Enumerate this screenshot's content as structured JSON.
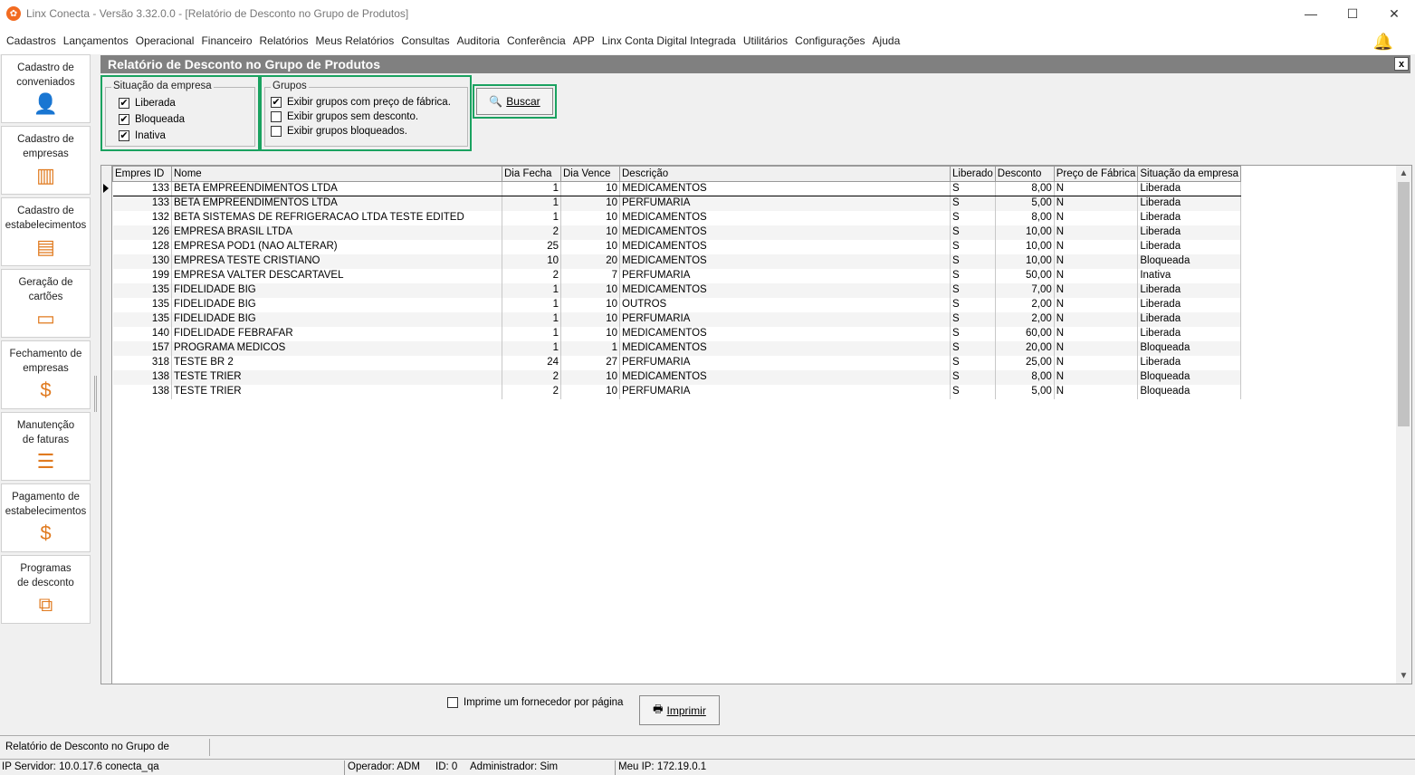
{
  "window": {
    "title": "Linx Conecta - Versão 3.32.0.0 - [Relatório de Desconto no Grupo de Produtos]",
    "minimize": "—",
    "maximize": "☐",
    "close": "✕"
  },
  "menu": [
    "Cadastros",
    "Lançamentos",
    "Operacional",
    "Financeiro",
    "Relatórios",
    "Meus Relatórios",
    "Consultas",
    "Auditoria",
    "Conferência",
    "APP",
    "Linx Conta Digital Integrada",
    "Utilitários",
    "Configurações",
    "Ajuda"
  ],
  "sidebar": [
    {
      "label1": "Cadastro de",
      "label2": "conveniados",
      "icon": "person-icon",
      "glyph": "👤"
    },
    {
      "label1": "Cadastro de",
      "label2": "empresas",
      "icon": "building-icon",
      "glyph": "▥"
    },
    {
      "label1": "Cadastro de",
      "label2": "estabelecimentos",
      "icon": "store-icon",
      "glyph": "▤"
    },
    {
      "label1": "Geração de",
      "label2": "cartões",
      "icon": "card-icon",
      "glyph": "▭"
    },
    {
      "label1": "Fechamento de",
      "label2": "empresas",
      "icon": "invoice-icon",
      "glyph": "$"
    },
    {
      "label1": "Manutenção",
      "label2": "de faturas",
      "icon": "tray-icon",
      "glyph": "☰"
    },
    {
      "label1": "Pagamento de",
      "label2": "estabelecimentos",
      "icon": "payment-icon",
      "glyph": "$"
    },
    {
      "label1": "Programas",
      "label2": "de desconto",
      "icon": "discount-icon",
      "glyph": "⧉"
    }
  ],
  "panel": {
    "title": "Relatório de Desconto no Grupo de Produtos",
    "close": "x"
  },
  "situacao": {
    "legend": "Situação da empresa",
    "options": [
      {
        "label": "Liberada",
        "checked": "✔"
      },
      {
        "label": "Bloqueada",
        "checked": "✔"
      },
      {
        "label": "Inativa",
        "checked": "✔"
      }
    ]
  },
  "grupos": {
    "legend": "Grupos",
    "options": [
      {
        "label": "Exibir grupos com preço de fábrica.",
        "checked": "✔"
      },
      {
        "label": "Exibir grupos sem desconto.",
        "checked": ""
      },
      {
        "label": "Exibir grupos bloqueados.",
        "checked": ""
      }
    ]
  },
  "buscar_label": "Buscar",
  "grid": {
    "columns": [
      "Empres ID",
      "Nome",
      "Dia Fecha",
      "Dia Vence",
      "Descrição",
      "Liberado",
      "Desconto",
      "Preço de Fábrica",
      "Situação da empresa"
    ],
    "rows": [
      [
        "133",
        "BETA EMPREENDIMENTOS LTDA",
        "1",
        "10",
        "MEDICAMENTOS",
        "S",
        "8,00",
        "N",
        "Liberada"
      ],
      [
        "133",
        "BETA EMPREENDIMENTOS LTDA",
        "1",
        "10",
        "PERFUMARIA",
        "S",
        "5,00",
        "N",
        "Liberada"
      ],
      [
        "132",
        "BETA SISTEMAS DE REFRIGERACAO LTDA TESTE EDITED",
        "1",
        "10",
        "MEDICAMENTOS",
        "S",
        "8,00",
        "N",
        "Liberada"
      ],
      [
        "126",
        "EMPRESA BRASIL LTDA",
        "2",
        "10",
        "MEDICAMENTOS",
        "S",
        "10,00",
        "N",
        "Liberada"
      ],
      [
        "128",
        "EMPRESA POD1 (NAO ALTERAR)",
        "25",
        "10",
        "MEDICAMENTOS",
        "S",
        "10,00",
        "N",
        "Liberada"
      ],
      [
        "130",
        "EMPRESA TESTE CRISTIANO",
        "10",
        "20",
        "MEDICAMENTOS",
        "S",
        "10,00",
        "N",
        "Bloqueada"
      ],
      [
        "199",
        "EMPRESA VALTER DESCARTAVEL",
        "2",
        "7",
        "PERFUMARIA",
        "S",
        "50,00",
        "N",
        "Inativa"
      ],
      [
        "135",
        "FIDELIDADE BIG",
        "1",
        "10",
        "MEDICAMENTOS",
        "S",
        "7,00",
        "N",
        "Liberada"
      ],
      [
        "135",
        "FIDELIDADE BIG",
        "1",
        "10",
        "OUTROS",
        "S",
        "2,00",
        "N",
        "Liberada"
      ],
      [
        "135",
        "FIDELIDADE BIG",
        "1",
        "10",
        "PERFUMARIA",
        "S",
        "2,00",
        "N",
        "Liberada"
      ],
      [
        "140",
        "FIDELIDADE FEBRAFAR",
        "1",
        "10",
        "MEDICAMENTOS",
        "S",
        "60,00",
        "N",
        "Liberada"
      ],
      [
        "157",
        "PROGRAMA MEDICOS",
        "1",
        "1",
        "MEDICAMENTOS",
        "S",
        "20,00",
        "N",
        "Bloqueada"
      ],
      [
        "318",
        "TESTE BR 2",
        "24",
        "27",
        "PERFUMARIA",
        "S",
        "25,00",
        "N",
        "Liberada"
      ],
      [
        "138",
        "TESTE TRIER",
        "2",
        "10",
        "MEDICAMENTOS",
        "S",
        "8,00",
        "N",
        "Bloqueada"
      ],
      [
        "138",
        "TESTE TRIER",
        "2",
        "10",
        "PERFUMARIA",
        "S",
        "5,00",
        "N",
        "Bloqueada"
      ]
    ]
  },
  "imprime_fornecedor_label": "Imprime um fornecedor por página",
  "imprimir_label": "Imprimir",
  "status_tab": "Relatório de Desconto no Grupo de Produtos",
  "status": {
    "servidor": "IP Servidor: 10.0.17.6 conecta_qa",
    "operador": "Operador: ADM",
    "id": "ID: 0",
    "admin": "Administrador: Sim",
    "meu_ip": "Meu IP: 172.19.0.1"
  },
  "colors": {
    "accent_green": "#1aa260",
    "brand_orange": "#f26b21"
  }
}
